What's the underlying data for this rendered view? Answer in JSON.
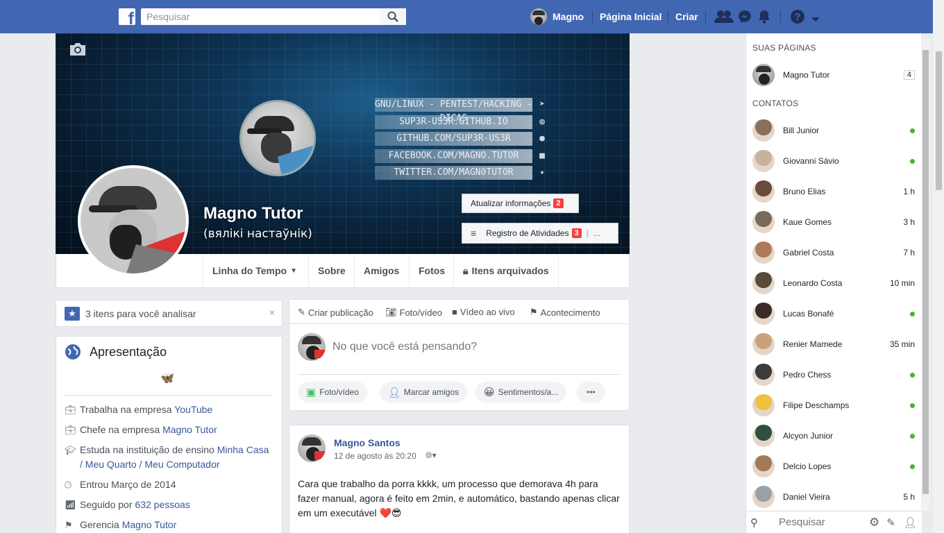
{
  "topbar": {
    "logo": "f",
    "search_placeholder": "Pesquisar",
    "user_name": "Magno",
    "home": "Página Inicial",
    "create": "Criar"
  },
  "cover": {
    "bars": [
      {
        "text": "GNU/LINUX - PENTEST/HACKING - DICAS",
        "icon": "cursor-icon"
      },
      {
        "text": "SUP3R-US3R.GITHUB.IO",
        "icon": "globe-icon"
      },
      {
        "text": "GITHUB.COM/SUP3R-US3R",
        "icon": "github-icon"
      },
      {
        "text": "FACEBOOK.COM/MAGNO.TUTOR",
        "icon": "facebook-icon"
      },
      {
        "text": "TWITTER.COM/MAGN0TUTOR",
        "icon": "twitter-icon"
      }
    ],
    "name": "Magno Tutor",
    "subname": "(вялікі настаўнік)",
    "update_info": "Atualizar informações",
    "update_info_count": "2",
    "activity_log": "Registro de Atividades",
    "activity_log_count": "3",
    "more": "..."
  },
  "tabs": [
    "Linha do Tempo",
    "Sobre",
    "Amigos",
    "Fotos",
    "Itens arquivados"
  ],
  "review": {
    "text": "3 itens para você analisar"
  },
  "intro": {
    "title": "Apresentação",
    "bio_emoji": "🦋",
    "items": [
      {
        "icon": "briefcase-icon",
        "text": "Trabalha na empresa ",
        "link": "YouTube"
      },
      {
        "icon": "briefcase-icon",
        "text": "Chefe na empresa ",
        "link": "Magno Tutor"
      },
      {
        "icon": "graduation-cap-icon",
        "text": "Estuda na instituição de ensino ",
        "link": "Minha Casa / Meu Quarto / Meu Computador"
      },
      {
        "icon": "clock-icon",
        "text": "Entrou Março de 2014",
        "link": ""
      },
      {
        "icon": "wifi-icon",
        "text": "Seguido por ",
        "link": "632 pessoas"
      },
      {
        "icon": "flag-icon",
        "text": "Gerencia ",
        "link": "Magno Tutor"
      }
    ]
  },
  "composer": {
    "tabs": [
      "Criar publicação",
      "Foto/vídeo",
      "Vídeo ao vivo",
      "Acontecimento"
    ],
    "placeholder": "No que você está pensando?",
    "actions": [
      "Foto/vídeo",
      "Marcar amigos",
      "Sentimentos/a...",
      "•••"
    ]
  },
  "post": {
    "author": "Magno Santos",
    "date": "12 de agosto às 20:20",
    "text": "Cara que trabalho da porra kkkk, um processo que demorava 4h para fazer manual, agora é feito em 2min, e automático, bastando apenas clicar em um executável",
    "emojis": "❤️😎"
  },
  "sidebar": {
    "pages_title": "SUAS PÁGINAS",
    "page": {
      "name": "Magno Tutor",
      "count": "4"
    },
    "contacts_title": "CONTATOS",
    "contacts": [
      {
        "name": "Bill Junior",
        "status": "online"
      },
      {
        "name": "Giovanni Sávio",
        "status": "online"
      },
      {
        "name": "Bruno Elias",
        "status": "1 h"
      },
      {
        "name": "Kaue Gomes",
        "status": "3 h"
      },
      {
        "name": "Gabriel Costa",
        "status": "7 h"
      },
      {
        "name": "Leonardo Costa",
        "status": "10 min"
      },
      {
        "name": "Lucas Bonafé",
        "status": "online"
      },
      {
        "name": "Renier Mamede",
        "status": "35 min"
      },
      {
        "name": "Pedro Chess",
        "status": "online"
      },
      {
        "name": "Filipe Deschamps",
        "status": "online"
      },
      {
        "name": "Alcyon Junior",
        "status": "online"
      },
      {
        "name": "Delcio Lopes",
        "status": "online"
      },
      {
        "name": "Daniel Vieira",
        "status": "5 h"
      }
    ],
    "search_placeholder": "Pesquisar"
  },
  "colors": {
    "brand": "#4267b2",
    "online": "#42b72a",
    "badge": "#fa3e3e"
  }
}
